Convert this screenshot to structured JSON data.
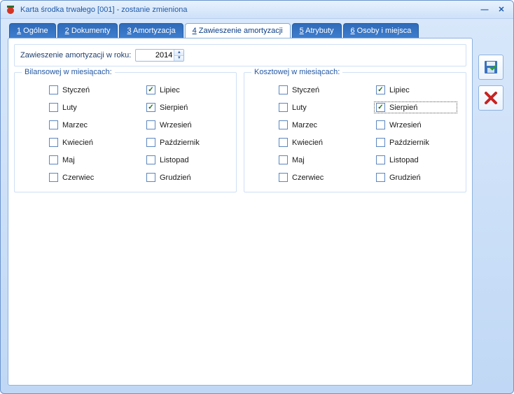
{
  "window": {
    "title": "Karta środka trwałego [001] - zostanie zmieniona"
  },
  "tabs": [
    {
      "n": "1",
      "label": "Ogólne"
    },
    {
      "n": "2",
      "label": "Dokumenty"
    },
    {
      "n": "3",
      "label": "Amortyzacja"
    },
    {
      "n": "4",
      "label": "Zawieszenie amortyzacji"
    },
    {
      "n": "5",
      "label": "Atrybuty"
    },
    {
      "n": "6",
      "label": "Osoby i miejsca"
    }
  ],
  "active_tab": 3,
  "year_label": "Zawieszenie amortyzacji w roku:",
  "year_value": "2014",
  "group_bilans": {
    "legend": "Bilansowej w miesiącach:"
  },
  "group_koszt": {
    "legend": "Kosztowej w miesiącach:"
  },
  "months_left": [
    "Styczeń",
    "Luty",
    "Marzec",
    "Kwiecień",
    "Maj",
    "Czerwiec"
  ],
  "months_right": [
    "Lipiec",
    "Sierpień",
    "Wrzesień",
    "Październik",
    "Listopad",
    "Grudzień"
  ],
  "checked_bilans": [
    "Lipiec",
    "Sierpień"
  ],
  "checked_koszt": [
    "Lipiec",
    "Sierpień"
  ],
  "focused_koszt": "Sierpień",
  "side_buttons": {
    "save": "Zapisz",
    "cancel": "Anuluj"
  }
}
